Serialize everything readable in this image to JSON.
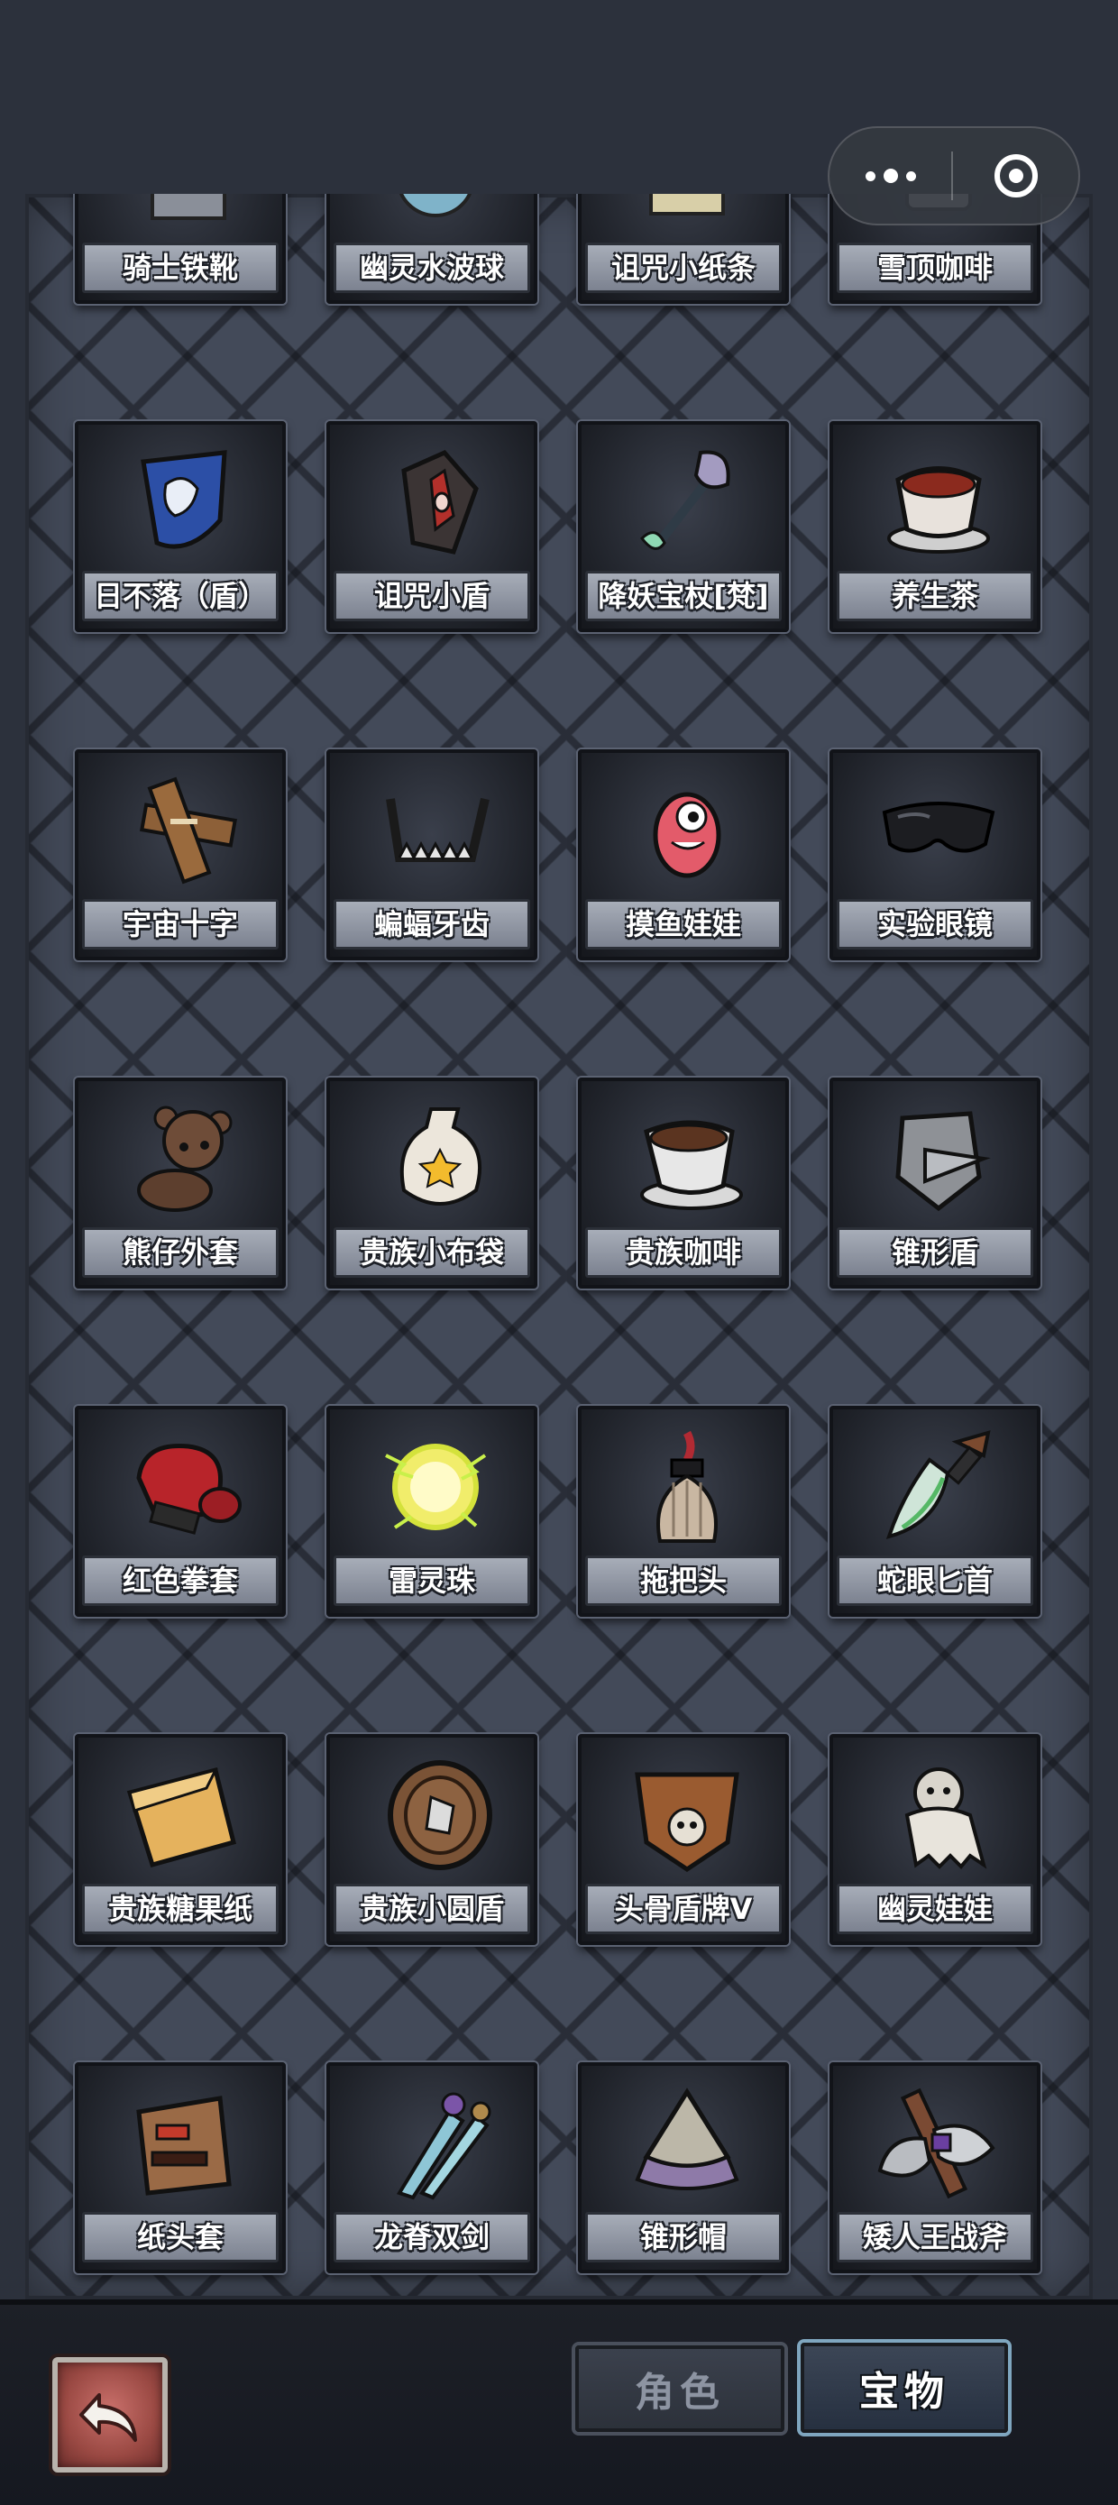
{
  "grid_items": [
    {
      "label": "骑士铁靴",
      "icon": "iron-boots-icon"
    },
    {
      "label": "幽灵水波球",
      "icon": "ghost-orb-icon"
    },
    {
      "label": "诅咒小纸条",
      "icon": "cursed-note-icon"
    },
    {
      "label": "雪顶咖啡",
      "icon": "snow-coffee-icon"
    },
    {
      "label": "日不落（盾）",
      "icon": "blue-shield-icon"
    },
    {
      "label": "诅咒小盾",
      "icon": "cursed-shield-icon"
    },
    {
      "label": "降妖宝杖[梵]",
      "icon": "demon-staff-icon"
    },
    {
      "label": "养生茶",
      "icon": "health-tea-icon"
    },
    {
      "label": "宇宙十字",
      "icon": "cosmic-cross-icon"
    },
    {
      "label": "蝙蝠牙齿",
      "icon": "bat-teeth-icon"
    },
    {
      "label": "摸鱼娃娃",
      "icon": "slacker-doll-icon"
    },
    {
      "label": "实验眼镜",
      "icon": "lab-glasses-icon"
    },
    {
      "label": "熊仔外套",
      "icon": "bear-coat-icon"
    },
    {
      "label": "贵族小布袋",
      "icon": "noble-pouch-icon"
    },
    {
      "label": "贵族咖啡",
      "icon": "noble-coffee-icon"
    },
    {
      "label": "锥形盾",
      "icon": "cone-shield-icon"
    },
    {
      "label": "红色拳套",
      "icon": "boxing-glove-icon"
    },
    {
      "label": "雷灵珠",
      "icon": "thunder-orb-icon"
    },
    {
      "label": "拖把头",
      "icon": "mop-head-icon"
    },
    {
      "label": "蛇眼匕首",
      "icon": "snake-dagger-icon"
    },
    {
      "label": "贵族糖果纸",
      "icon": "candy-wrapper-icon"
    },
    {
      "label": "贵族小圆盾",
      "icon": "round-shield-icon"
    },
    {
      "label": "头骨盾牌V",
      "icon": "skull-shield-icon"
    },
    {
      "label": "幽灵娃娃",
      "icon": "ghost-doll-icon"
    },
    {
      "label": "纸头套",
      "icon": "paper-bag-icon"
    },
    {
      "label": "龙脊双剑",
      "icon": "dragon-swords-icon"
    },
    {
      "label": "锥形帽",
      "icon": "cone-hat-icon"
    },
    {
      "label": "矮人王战斧",
      "icon": "dwarf-axe-icon"
    },
    {
      "label": "",
      "icon": "purple-item-icon"
    },
    {
      "label": "",
      "icon": "brown-item-icon"
    },
    {
      "label": "",
      "icon": "orange-item-icon"
    },
    {
      "label": "",
      "icon": "red-item-icon"
    }
  ],
  "bottom_nav": {
    "back_icon": "back-arrow-icon",
    "tab_role": "角色",
    "tab_treasure": "宝物",
    "active_tab": "宝物"
  },
  "capsule": {
    "more_icon": "more-dots-icon",
    "close_icon": "close-target-icon"
  }
}
